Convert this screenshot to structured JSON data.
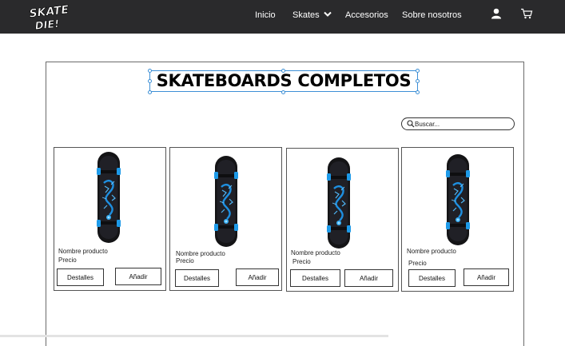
{
  "nav": {
    "logo_text_top": "SKATE",
    "logo_text_bottom": "DIE!",
    "links": [
      "Inicio",
      "Skates",
      "Accesorios",
      "Sobre nosotros"
    ],
    "skates_dropdown_icon": "chevron-down-icon",
    "user_icon": "user-icon",
    "cart_icon": "cart-icon"
  },
  "page": {
    "title": "SKATEBOARDS COMPLETOS",
    "search_placeholder": "Buscar..."
  },
  "products": [
    {
      "name": "Nombre producto",
      "price": "Precio",
      "details_label": "Destalles",
      "add_label": "Añadir"
    },
    {
      "name": "Nombre producto",
      "price": "Precio",
      "details_label": "Destalles",
      "add_label": "Añadir"
    },
    {
      "name": "Nombre producto",
      "price": "Precio",
      "details_label": "Destalles",
      "add_label": "Añadir"
    },
    {
      "name": "Nombre producto",
      "price": "Precio",
      "details_label": "Destalles",
      "add_label": "Añadir"
    }
  ],
  "colors": {
    "nav_bg": "#2a2a2c",
    "selection_blue": "#3d8fd6",
    "board_blue": "#1e8fe0"
  }
}
